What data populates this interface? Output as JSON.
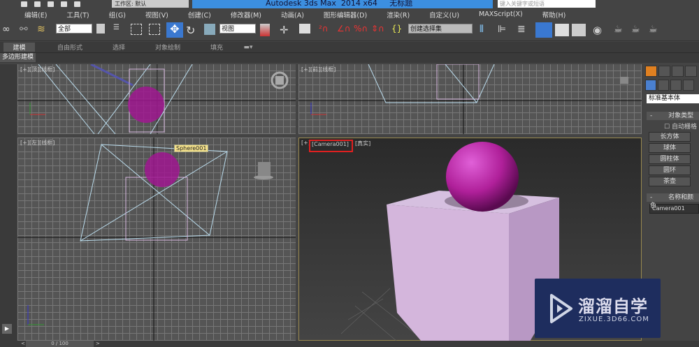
{
  "title_bar": {
    "app_title": "Autodesk 3ds Max  2014 x64     无标题",
    "workspace": "工作区: 默认",
    "search_placeholder": "键入关键字或短语"
  },
  "menu": [
    "编辑(E)",
    "工具(T)",
    "组(G)",
    "视图(V)",
    "创建(C)",
    "修改器(M)",
    "动画(A)",
    "图形编辑器(D)",
    "渲染(R)",
    "自定义(U)",
    "MAXScript(X)",
    "帮助(H)"
  ],
  "toolbar": {
    "selection_filter": "全部",
    "ref_coord": "视图",
    "named_selection": "创建选择集"
  },
  "ribbon": {
    "tabs": [
      "建模",
      "自由形式",
      "选择",
      "对象绘制",
      "填充"
    ],
    "subtab": "多边形建模"
  },
  "viewports": {
    "top": "[+][顶][线框]",
    "front": "[+][前][线框]",
    "left": "[+][左][线框]",
    "camera_plus": "[+]",
    "camera_name": "[Camera001]",
    "camera_shading": "[真实]",
    "tooltip": "Sphere001"
  },
  "command_panel": {
    "category": "标准基本体",
    "object_type_header": "对象类型",
    "autogrid": "自动栅格",
    "buttons": [
      "长方体",
      "球体",
      "圆柱体",
      "圆环",
      "茶壶"
    ],
    "name_color_header": "名称和颜色",
    "name_value": "Camera001"
  },
  "timeline": {
    "frame": "0 / 100"
  },
  "watermark": {
    "brand": "溜溜自学",
    "url": "ZIXUE.3D66.COM"
  },
  "colors": {
    "title_blue": "#3c8fe0",
    "sphere": "#b0209a",
    "box": "#e0c0e8",
    "highlight_red": "#e02020"
  }
}
